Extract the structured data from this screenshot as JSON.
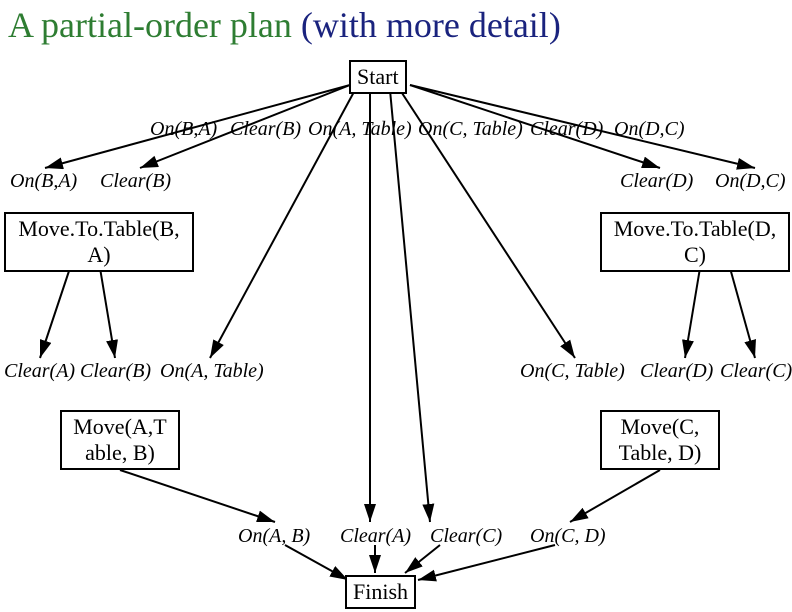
{
  "title": {
    "part1": "A partial-order plan",
    "part2": "(with more detail)"
  },
  "nodes": {
    "start": "Start",
    "finish": "Finish",
    "move_b_a": "Move.To.Table(B, A)",
    "move_d_c": "Move.To.Table(D, C)",
    "move_a_tb": "Move(A,T able, B)",
    "move_c_td": "Move(C, Table, D)"
  },
  "labels": {
    "row1": {
      "on_b_a": "On(B,A)",
      "clear_b": "Clear(B)",
      "on_a_table": "On(A, Table)",
      "on_c_table": "On(C, Table)",
      "clear_d": "Clear(D)",
      "on_d_c": "On(D,C)"
    },
    "row2_left": {
      "on_b_a": "On(B,A)",
      "clear_b": "Clear(B)"
    },
    "row2_right": {
      "clear_d": "Clear(D)",
      "on_d_c": "On(D,C)"
    },
    "row3_left": {
      "clear_a": "Clear(A)",
      "clear_b": "Clear(B)",
      "on_a_table": "On(A, Table)"
    },
    "row3_right": {
      "on_c_table": "On(C, Table)",
      "clear_d": "Clear(D)",
      "clear_c": "Clear(C)"
    },
    "row4": {
      "on_a_b": "On(A, B)",
      "clear_a": "Clear(A)",
      "clear_c": "Clear(C)",
      "on_c_d": "On(C, D)"
    }
  }
}
